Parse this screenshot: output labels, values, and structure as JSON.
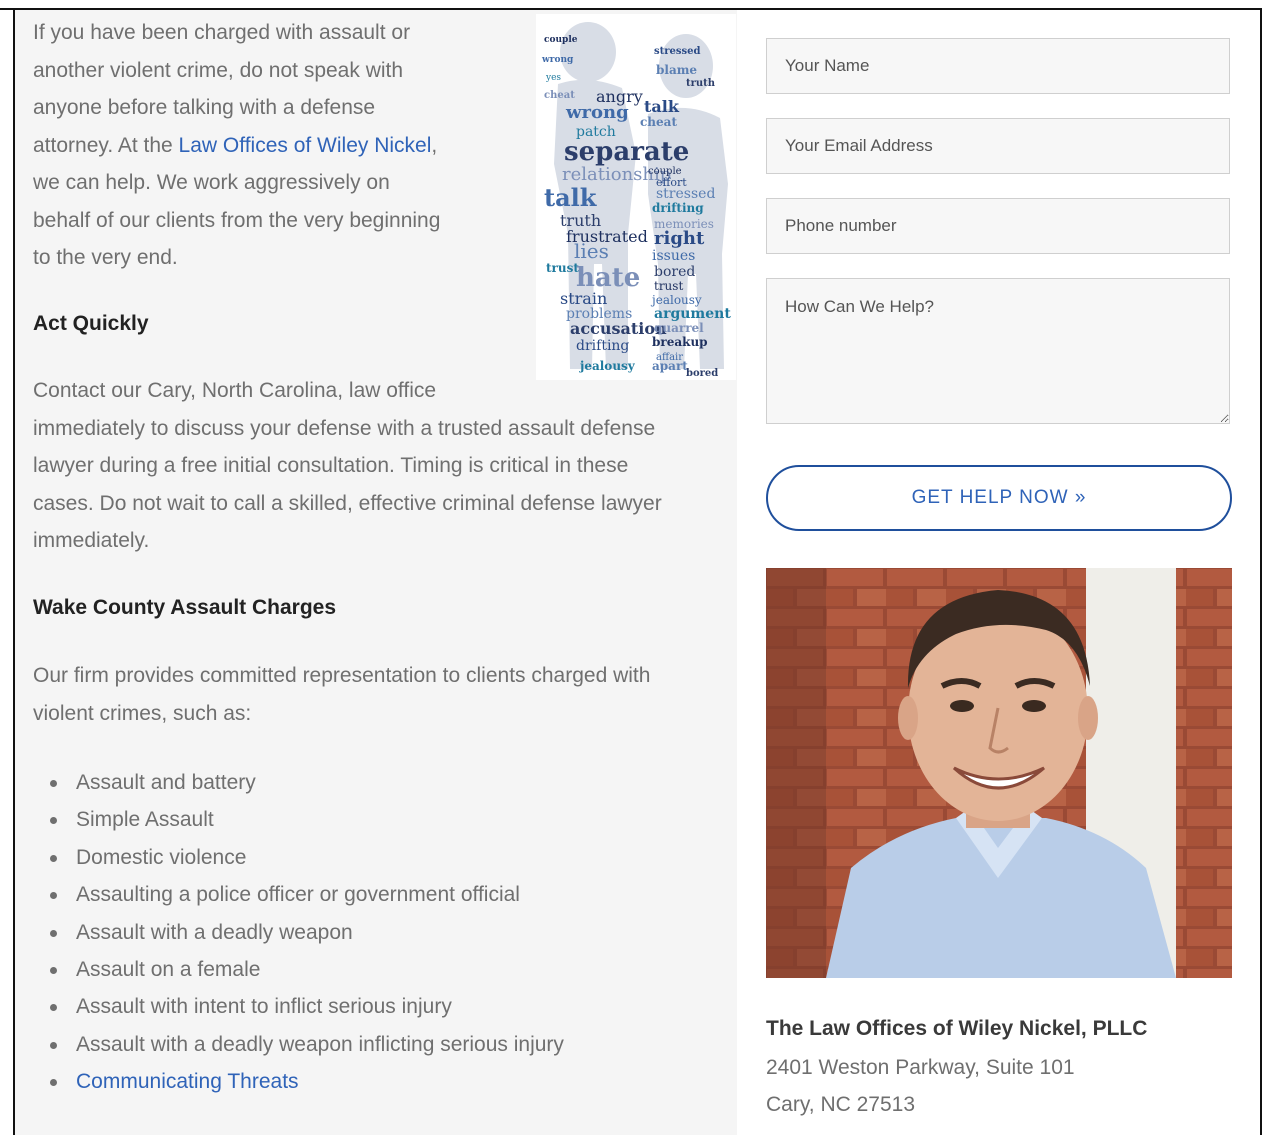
{
  "article": {
    "intro_lines": [
      "If you have been charged with assault or",
      "another violent crime, do not speak with",
      "anyone before talking with a defense",
      "attorney. At the ",
      "we can help. We work aggressively on",
      "behalf of our clients from the very beginning",
      "to the very end."
    ],
    "intro_link": "Law Offices of Wiley Nickel",
    "intro_link_suffix": ",",
    "heading_act": "Act Quickly",
    "act_lines": [
      "Contact our Cary, North Carolina, law office",
      "immediately to discuss your defense with a trusted assault defense",
      "lawyer during a free initial consultation. Timing is critical in these",
      "cases. Do not wait to call a skilled, effective criminal defense lawyer",
      "immediately."
    ],
    "heading_wake": "Wake County Assault Charges",
    "wake_lines": [
      "Our firm provides committed representation to clients charged with",
      "violent crimes, such as:"
    ],
    "charges": [
      "Assault and battery",
      "Simple Assault",
      "Domestic violence",
      "Assaulting a police officer or government official",
      "Assault with a deadly weapon",
      "Assault on a female",
      "Assault with intent to inflict serious injury",
      "Assault with a deadly weapon inflicting serious injury"
    ],
    "charge_link": "Communicating Threats"
  },
  "word_cloud": {
    "words": [
      "couple",
      "stressed",
      "wrong",
      "blame",
      "yes",
      "truth",
      "cheat",
      "angry",
      "talk",
      "wrong",
      "cheat",
      "patch",
      "separate",
      "relationship",
      "couple",
      "effort",
      "talk",
      "stressed",
      "drifting",
      "truth",
      "memories",
      "frustrated",
      "right",
      "issues",
      "lies",
      "trust",
      "bored",
      "hate",
      "trust",
      "strain",
      "jealousy",
      "problems",
      "argument",
      "accusation",
      "quarrel",
      "breakup",
      "drifting",
      "affair",
      "apart",
      "jealousy",
      "bored"
    ]
  },
  "form": {
    "name_placeholder": "Your Name",
    "email_placeholder": "Your Email Address",
    "phone_placeholder": "Phone number",
    "help_placeholder": "How Can We Help?",
    "submit_label": "GET HELP NOW »"
  },
  "contact": {
    "firm_name": "The Law Offices of Wiley Nickel, PLLC",
    "address_line1": "2401 Weston Parkway, Suite 101",
    "address_line2": "Cary, NC 27513"
  },
  "colors": {
    "link": "#2f63b8",
    "button_border": "#1f4f9c",
    "body_text": "#6f6f6f",
    "heading": "#222222",
    "left_bg": "#f5f5f5"
  }
}
